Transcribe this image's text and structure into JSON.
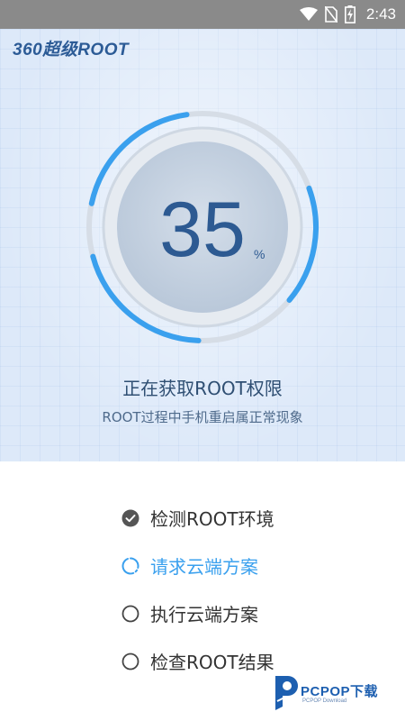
{
  "status_bar": {
    "time": "2:43"
  },
  "app": {
    "title": "360超级ROOT"
  },
  "progress": {
    "value": "35",
    "unit": "%",
    "fraction": 0.35
  },
  "status": {
    "title": "正在获取ROOT权限",
    "subtitle": "ROOT过程中手机重启属正常现象"
  },
  "steps": [
    {
      "label": "检测ROOT环境",
      "state": "done"
    },
    {
      "label": "请求云端方案",
      "state": "in-progress"
    },
    {
      "label": "执行云端方案",
      "state": "pending"
    },
    {
      "label": "检查ROOT结果",
      "state": "pending"
    }
  ],
  "watermark": {
    "brand": "PCPOP下载",
    "sub": "PCPOP Download"
  },
  "colors": {
    "accent": "#3aa0ee",
    "navy": "#2d5a92",
    "status_bar": "#8a8a8a"
  }
}
